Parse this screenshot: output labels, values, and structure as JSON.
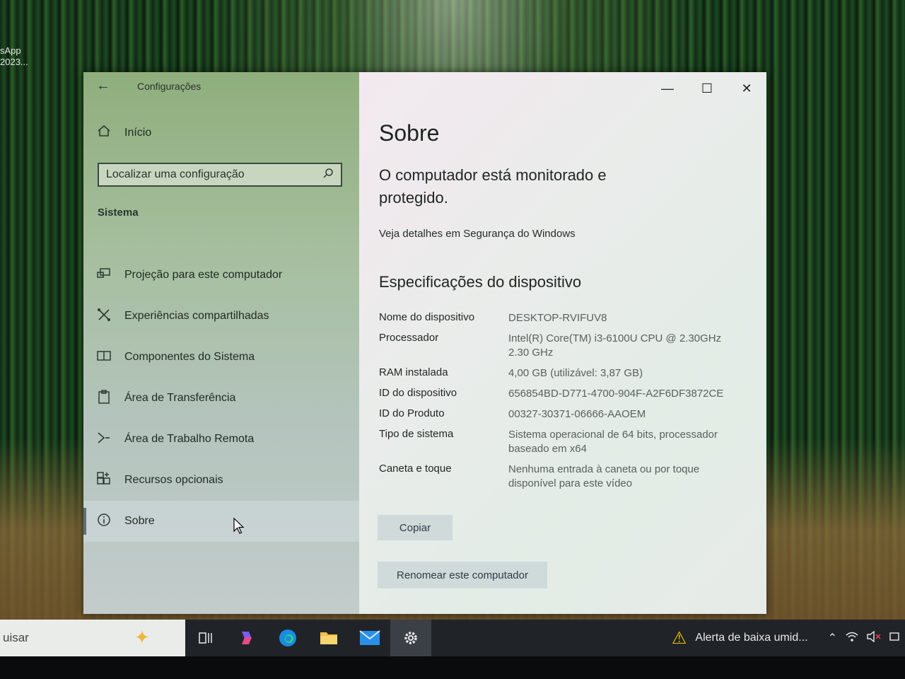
{
  "desktop": {
    "icon_label_1": "sApp",
    "icon_label_2": "2023..."
  },
  "window": {
    "title": "Configurações",
    "controls": {
      "minimize": "—",
      "maximize": "☐",
      "close": "✕"
    }
  },
  "sidebar": {
    "home_label": "Início",
    "search_placeholder": "Localizar uma configuração",
    "section_label": "Sistema",
    "items": [
      {
        "label": "Projeção para este computador",
        "icon": "projection-icon"
      },
      {
        "label": "Experiências compartilhadas",
        "icon": "shared-experiences-icon"
      },
      {
        "label": "Componentes do Sistema",
        "icon": "system-components-icon"
      },
      {
        "label": "Área de Transferência",
        "icon": "clipboard-icon"
      },
      {
        "label": "Área de Trabalho Remota",
        "icon": "remote-desktop-icon"
      },
      {
        "label": "Recursos opcionais",
        "icon": "optional-features-icon"
      },
      {
        "label": "Sobre",
        "icon": "info-icon",
        "selected": true
      }
    ]
  },
  "content": {
    "page_title": "Sobre",
    "status_text": "O computador está monitorado e protegido.",
    "security_link": "Veja detalhes em Segurança do Windows",
    "spec_title": "Especificações do dispositivo",
    "specs": [
      {
        "label": "Nome do dispositivo",
        "value": "DESKTOP-RVIFUV8"
      },
      {
        "label": "Processador",
        "value": "Intel(R) Core(TM) i3-6100U CPU @ 2.30GHz 2.30 GHz"
      },
      {
        "label": "RAM instalada",
        "value": "4,00 GB (utilizável: 3,87 GB)"
      },
      {
        "label": "ID do dispositivo",
        "value": "656854BD-D771-4700-904F-A2F6DF3872CE"
      },
      {
        "label": "ID do Produto",
        "value": "00327-30371-06666-AAOEM"
      },
      {
        "label": "Tipo de sistema",
        "value": "Sistema operacional de 64 bits, processador baseado em x64"
      },
      {
        "label": "Caneta e toque",
        "value": "Nenhuma entrada à caneta ou por toque disponível para este vídeo"
      }
    ],
    "copy_button": "Copiar",
    "rename_button": "Renomear este computador"
  },
  "taskbar": {
    "search_placeholder": "uisar",
    "alert_text": "Alerta de baixa umid...",
    "accent": "#f2c20a"
  }
}
